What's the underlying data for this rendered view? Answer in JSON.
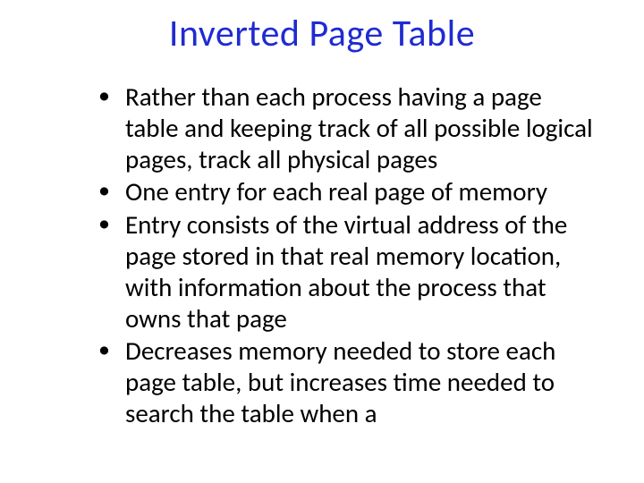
{
  "title": {
    "text": "Inverted Page Table",
    "color": "#1f2bd1"
  },
  "bullets": [
    "Rather than each process having a page table and keeping track of all possible logical pages, track all physical pages",
    "One entry for each real page of memory",
    "Entry consists of the virtual address of the page stored in that real memory location, with information about the process that owns that page",
    "Decreases memory needed to store each page table, but increases time needed to search the table when a"
  ]
}
